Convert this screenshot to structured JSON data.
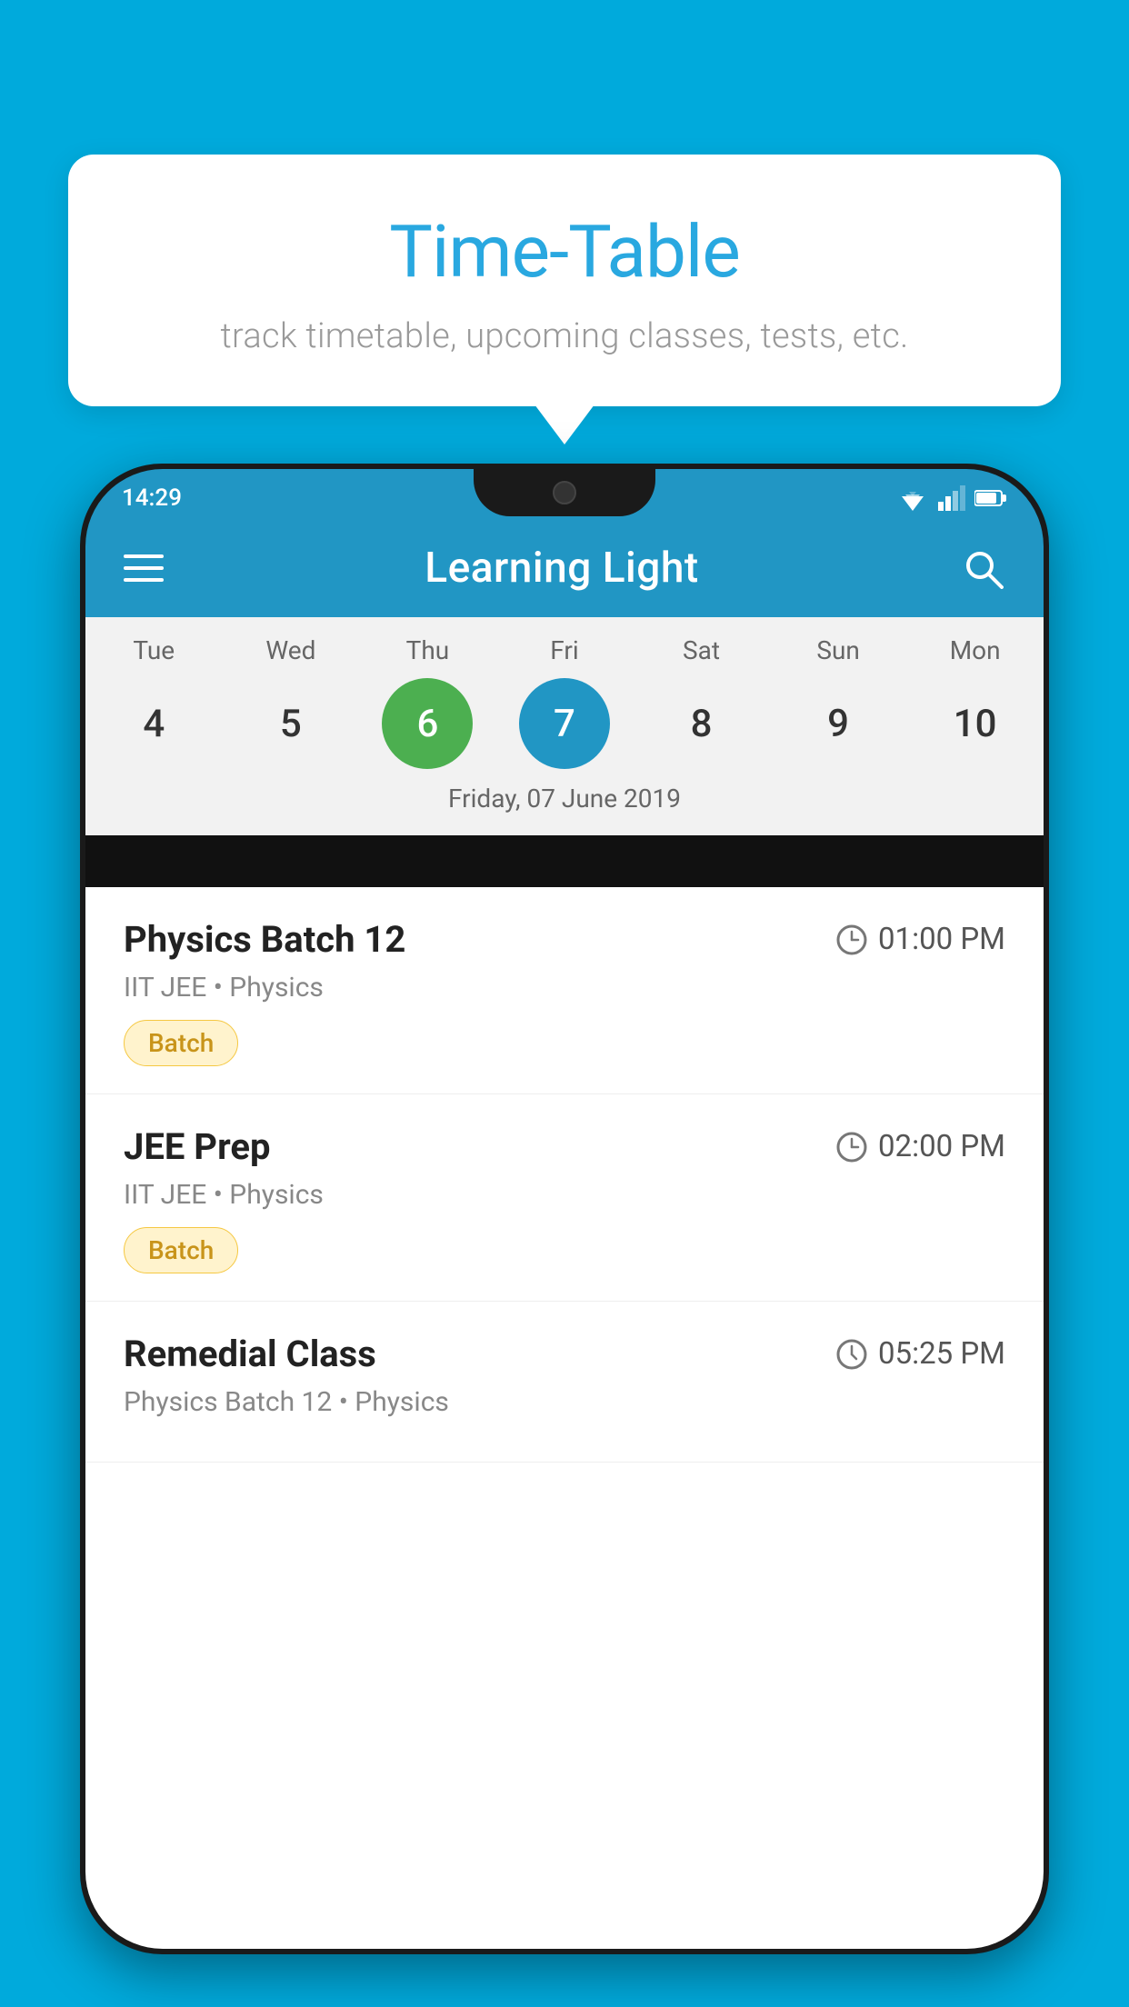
{
  "background_color": "#00AADC",
  "tooltip": {
    "title": "Time-Table",
    "subtitle": "track timetable, upcoming classes, tests, etc."
  },
  "status_bar": {
    "time": "14:29"
  },
  "app_bar": {
    "title": "Learning Light",
    "menu_icon": "hamburger-icon",
    "search_icon": "search-icon"
  },
  "calendar": {
    "selected_date_label": "Friday, 07 June 2019",
    "days": [
      {
        "label": "Tue",
        "number": "4",
        "state": "normal"
      },
      {
        "label": "Wed",
        "number": "5",
        "state": "normal"
      },
      {
        "label": "Thu",
        "number": "6",
        "state": "today"
      },
      {
        "label": "Fri",
        "number": "7",
        "state": "selected"
      },
      {
        "label": "Sat",
        "number": "8",
        "state": "normal"
      },
      {
        "label": "Sun",
        "number": "9",
        "state": "normal"
      },
      {
        "label": "Mon",
        "number": "10",
        "state": "normal"
      }
    ]
  },
  "schedule": [
    {
      "title": "Physics Batch 12",
      "time": "01:00 PM",
      "subtitle": "IIT JEE • Physics",
      "badge": "Batch",
      "badge_type": "batch"
    },
    {
      "title": "JEE Prep",
      "time": "02:00 PM",
      "subtitle": "IIT JEE • Physics",
      "badge": "Batch",
      "badge_type": "batch"
    },
    {
      "title": "Remedial Class",
      "time": "05:25 PM",
      "subtitle": "Physics Batch 12 • Physics",
      "badge": null,
      "badge_type": null
    }
  ]
}
